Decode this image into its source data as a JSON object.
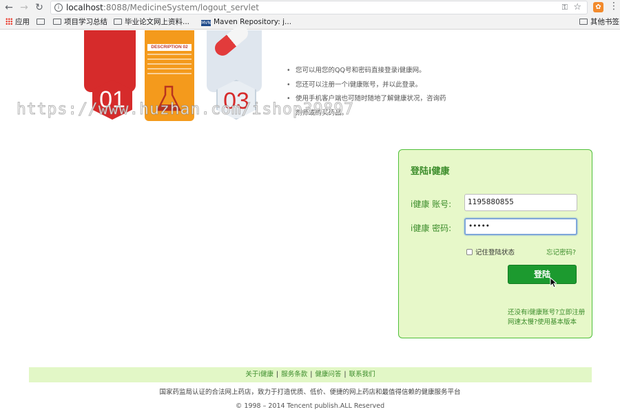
{
  "browser": {
    "url_host": "localhost",
    "url_path": ":8088/MedicineSystem/logout_servlet",
    "bookmarks": [
      {
        "label": "应用"
      },
      {
        "label": ""
      },
      {
        "label": "项目学习总结"
      },
      {
        "label": "毕业论文网上资料..."
      },
      {
        "label": "Maven Repository: j..."
      }
    ],
    "other_bookmarks": "其他书签"
  },
  "banner": {
    "num1": "01",
    "desc_label": "DESCRIPTION 02",
    "num3": "03"
  },
  "watermark": "https://www.huzhan.com/ishop39897",
  "bullets": [
    "您可以用您的QQ号和密码直接登录i健康网。",
    "您还可以注册一个i健康账号，并以此登录。",
    "使用手机客户端也可随时随地了解健康状况，咨询药剂师或购买药品。"
  ],
  "login": {
    "title": "登陆i健康",
    "account_label": "i健康 账号:",
    "account_value": "1195880855",
    "password_label": "i健康 密码:",
    "password_value": "•••••",
    "remember_label": "记住登陆状态",
    "forgot_link": "忘记密码?",
    "submit_label": "登陆",
    "no_account_text": "还没有i健康账号?",
    "register_link": "立即注册",
    "slow_text": "网速太慢?",
    "basic_link": "使用基本版本"
  },
  "footer": {
    "links": [
      "关于i健康",
      "服务条款",
      "健康问答",
      "联系我们"
    ],
    "line1": "国家药监局认证的合法网上药店，致力于打造优质、低价、便捷的网上药店和最值得信赖的健康服务平台",
    "line2": "© 1998 – 2014 Tencent publish.ALL Reserved"
  },
  "colors": {
    "accent_green": "#3b8c2a",
    "button_green": "#1c9a2f",
    "login_bg": "#e7f8c9",
    "footer_bg": "#e2f7c6"
  }
}
